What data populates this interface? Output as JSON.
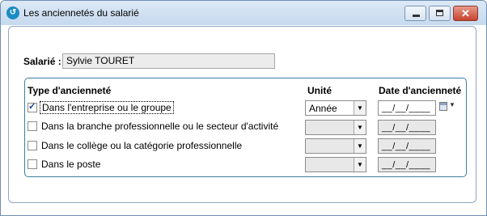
{
  "window": {
    "title": "Les anciennetés du salarié",
    "close_label": "✕"
  },
  "salarie": {
    "label": "Salarié :",
    "value": "Sylvie TOURET"
  },
  "table": {
    "headers": {
      "type": "Type d'ancienneté",
      "unite": "Unité",
      "date": "Date d'ancienneté"
    },
    "rows": [
      {
        "label": "Dans l'entreprise ou le groupe",
        "checked": true,
        "unite": "Année",
        "date": "__/__/____"
      },
      {
        "label": "Dans la branche professionnelle ou le secteur d'activité",
        "checked": false,
        "unite": "",
        "date": "__/__/____"
      },
      {
        "label": "Dans le collège ou la catégorie professionnelle",
        "checked": false,
        "unite": "",
        "date": "__/__/____"
      },
      {
        "label": "Dans le poste",
        "checked": false,
        "unite": "",
        "date": "__/__/____"
      }
    ]
  },
  "icons": {
    "app": "app-logo-icon",
    "calendar": "calendar-icon",
    "dropdown": "chevron-down-icon"
  }
}
